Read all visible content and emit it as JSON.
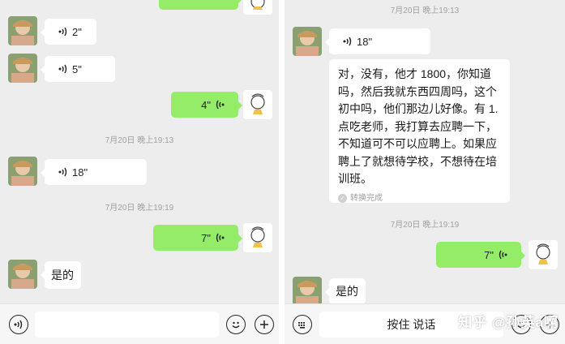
{
  "left": {
    "messages": [
      {
        "dir": "in",
        "duration": "2\""
      },
      {
        "dir": "in",
        "duration": "5\""
      },
      {
        "dir": "out",
        "duration": "4\""
      },
      {
        "dir": "in",
        "duration": "18\""
      },
      {
        "dir": "out",
        "duration": "7\""
      }
    ],
    "timestamps": [
      "7月20日 晚上19:13",
      "7月20日 晚上19:19"
    ],
    "last_text": "是的"
  },
  "right": {
    "top_timestamp": "7月20日 晚上19:13",
    "voice_18": "18\"",
    "transcript": "对，没有，他才 1800，你知道吗，然后我就东西四周吗，这个初中吗，他们那边儿好像。有 1.点吃老师，我打算去应聘一下，不知道可不可以应聘上。如果应聘上了就想待学校，不想待在培训班。",
    "conversion_status": "转换完成",
    "timestamp2": "7月20日 晚上19:19",
    "voice_7": "7\"",
    "last_text": "是的",
    "hold_to_talk": "按住 说话"
  },
  "watermark": "知乎 @孙英a啊",
  "colors": {
    "outgoing": "#95ec69",
    "incoming": "#ffffff",
    "background": "#ededed"
  },
  "icons": [
    "voice-toggle-icon",
    "emoji-icon",
    "add-icon",
    "keyboard-icon",
    "sound-wave-icon",
    "check-icon"
  ]
}
